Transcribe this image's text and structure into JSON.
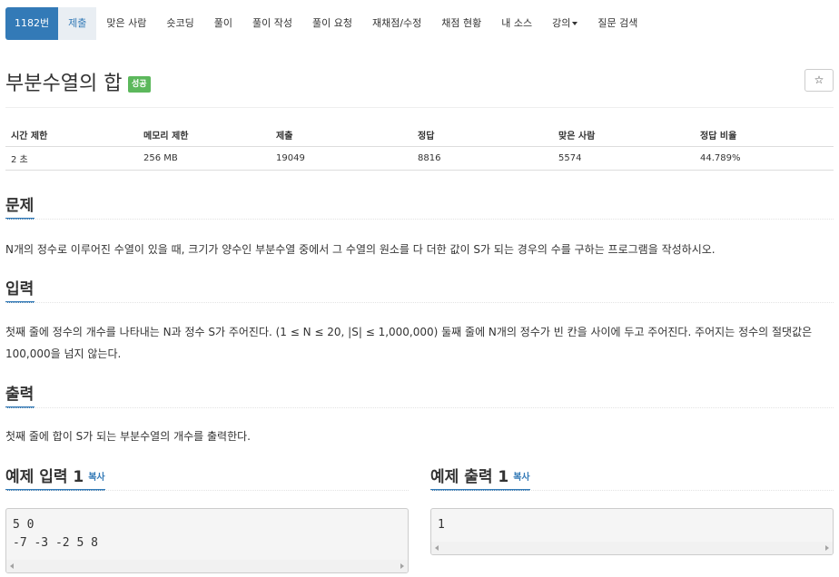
{
  "nav": {
    "items": [
      {
        "label": "1182번"
      },
      {
        "label": "제출"
      },
      {
        "label": "맞은 사람"
      },
      {
        "label": "숏코딩"
      },
      {
        "label": "풀이"
      },
      {
        "label": "풀이 작성"
      },
      {
        "label": "풀이 요청"
      },
      {
        "label": "재채점/수정"
      },
      {
        "label": "채점 현황"
      },
      {
        "label": "내 소스"
      },
      {
        "label": "강의"
      },
      {
        "label": "질문 검색"
      }
    ]
  },
  "problem": {
    "title": "부분수열의 합",
    "status_badge": "성공",
    "star_icon": "☆"
  },
  "info_table": {
    "headers": [
      "시간 제한",
      "메모리 제한",
      "제출",
      "정답",
      "맞은 사람",
      "정답 비율"
    ],
    "values": [
      "2 초",
      "256 MB",
      "19049",
      "8816",
      "5574",
      "44.789%"
    ]
  },
  "sections": {
    "description": {
      "heading": "문제",
      "text": "N개의 정수로 이루어진 수열이 있을 때, 크기가 양수인 부분수열 중에서 그 수열의 원소를 다 더한 값이 S가 되는 경우의 수를 구하는 프로그램을 작성하시오."
    },
    "input": {
      "heading": "입력",
      "text": "첫째 줄에 정수의 개수를 나타내는 N과 정수 S가 주어진다. (1 ≤ N ≤ 20, |S| ≤ 1,000,000) 둘째 줄에 N개의 정수가 빈 칸을 사이에 두고 주어진다. 주어지는 정수의 절댓값은 100,000을 넘지 않는다."
    },
    "output": {
      "heading": "출력",
      "text": "첫째 줄에 합이 S가 되는 부분수열의 개수를 출력한다."
    }
  },
  "samples": {
    "input": {
      "heading": "예제 입력 1",
      "copy_label": "복사",
      "content": "5 0\n-7 -3 -2 5 8"
    },
    "output": {
      "heading": "예제 출력 1",
      "copy_label": "복사",
      "content": "1"
    }
  },
  "colors": {
    "primary": "#337ab7",
    "success": "#5cb85c",
    "active_tab_bg": "#e9eef3"
  }
}
